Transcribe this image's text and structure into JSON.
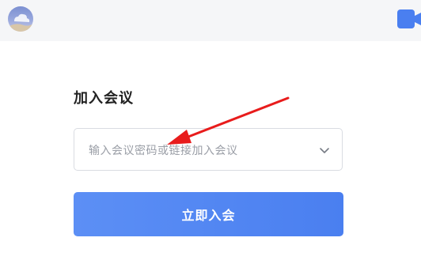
{
  "heading": "加入会议",
  "meeting_input": {
    "placeholder": "输入会议密码或链接加入会议"
  },
  "join_button": {
    "label": "立即入会"
  },
  "icons": {
    "avatar": "user-avatar",
    "app": "video-camera-icon",
    "dropdown": "chevron-down-icon",
    "annotation": "red-arrow-annotation"
  },
  "colors": {
    "primary": "#4a7ff0",
    "annotation": "#e81c1c"
  }
}
